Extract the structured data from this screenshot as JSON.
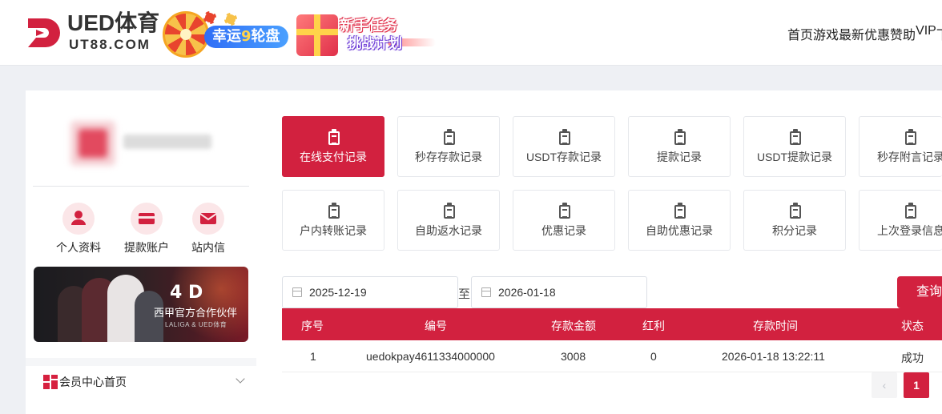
{
  "header": {
    "logo_text": "UED体育",
    "logo_sub": "UT88.COM",
    "promo_wheel_label_a": "幸运",
    "promo_wheel_label_num": "9",
    "promo_wheel_label_b": "轮盘",
    "promo_task_line1": "新手任务",
    "promo_task_line2": "挑战计划",
    "nav": [
      "首页",
      "游戏",
      "最新优惠",
      "赞助",
      "VIP",
      "下"
    ]
  },
  "sidebar": {
    "quick_links": [
      {
        "label": "个人资料",
        "icon": "user-icon"
      },
      {
        "label": "提款账户",
        "icon": "card-icon"
      },
      {
        "label": "站内信",
        "icon": "mail-icon"
      }
    ],
    "banner": {
      "logo": "4 D",
      "text": "西甲官方合作伙伴",
      "small": "LALIGA & UED体育"
    },
    "menu_home": "会员中心首页"
  },
  "main": {
    "tiles_row1": [
      "在线支付记录",
      "秒存存款记录",
      "USDT存款记录",
      "提款记录",
      "USDT提款记录",
      "秒存附言记录"
    ],
    "tiles_row2": [
      "户内转账记录",
      "自助返水记录",
      "优惠记录",
      "自助优惠记录",
      "积分记录",
      "上次登录信息"
    ],
    "active_tile": "在线支付记录",
    "date_from": "2025-12-19",
    "date_sep": "至",
    "date_to": "2026-01-18",
    "query_label": "查询",
    "table": {
      "headers": [
        "序号",
        "编号",
        "存款金额",
        "红利",
        "存款时间",
        "状态"
      ],
      "rows": [
        [
          "1",
          "uedokpay4611334000000",
          "3008",
          "0",
          "2026-01-18 13:22:11",
          "成功"
        ]
      ]
    },
    "pager": {
      "prev": "‹",
      "current": "1"
    }
  },
  "colors": {
    "accent": "#d2213f",
    "background": "#eef0f4"
  }
}
